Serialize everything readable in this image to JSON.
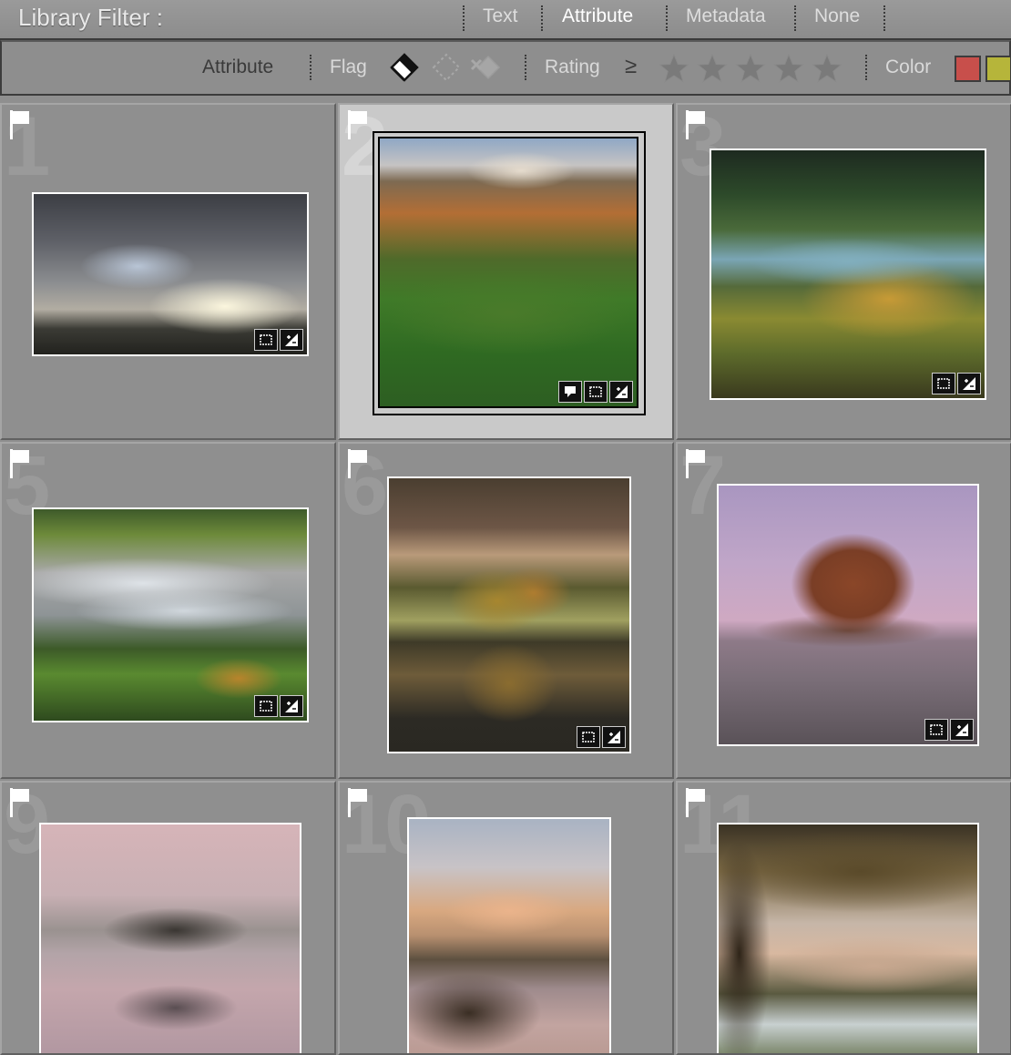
{
  "filterbar": {
    "title": "Library Filter :",
    "tabs": [
      "Text",
      "Attribute",
      "Metadata",
      "None"
    ],
    "active_tab": "Attribute"
  },
  "attrbar": {
    "attribute_label": "Attribute",
    "flag_label": "Flag",
    "rating_label": "Rating",
    "rating_operator": "≥",
    "color_label": "Color",
    "swatches": [
      "#c84f4b",
      "#b6b53a"
    ]
  },
  "grid": {
    "cells": [
      {
        "index": "1",
        "selected": false,
        "scene": "storm-clouds",
        "badges": [
          "crop-icon",
          "adjust-icon"
        ]
      },
      {
        "index": "2",
        "selected": true,
        "scene": "green-valley-aerial",
        "badges": [
          "comment-icon",
          "crop-icon",
          "adjust-icon"
        ]
      },
      {
        "index": "3",
        "selected": false,
        "scene": "misty-lake-autumn",
        "badges": [
          "crop-icon",
          "adjust-icon"
        ]
      },
      {
        "index": "5",
        "selected": false,
        "scene": "valley-fog",
        "badges": [
          "crop-icon",
          "adjust-icon"
        ]
      },
      {
        "index": "6",
        "selected": false,
        "scene": "tree-reflection",
        "badges": [
          "crop-icon",
          "adjust-icon"
        ]
      },
      {
        "index": "7",
        "selected": false,
        "scene": "frosty-trees-pink-sky",
        "badges": [
          "crop-icon",
          "adjust-icon"
        ]
      },
      {
        "index": "9",
        "selected": false,
        "scene": "misty-island-trees",
        "badges": []
      },
      {
        "index": "10",
        "selected": false,
        "scene": "lake-reeds-dawn",
        "badges": []
      },
      {
        "index": "11",
        "selected": false,
        "scene": "oak-branches-frost",
        "badges": []
      }
    ]
  }
}
